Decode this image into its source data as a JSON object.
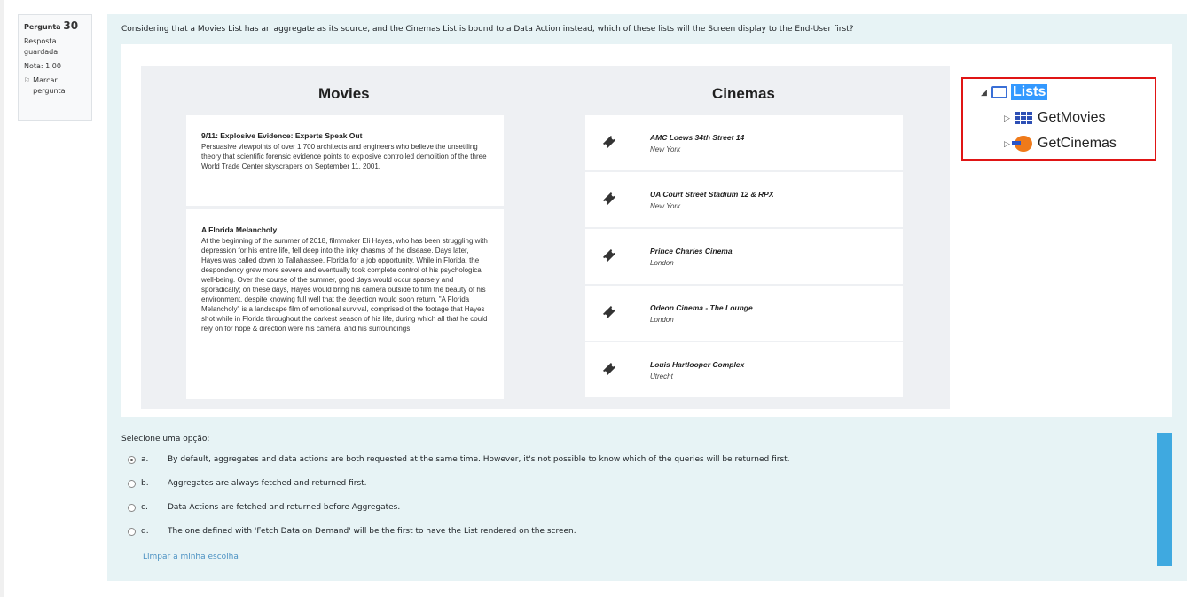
{
  "question_info": {
    "label": "Pergunta",
    "number": "30",
    "status": "Resposta guardada",
    "grade": "Nota: 1,00",
    "flag_label": "Marcar pergunta"
  },
  "question": {
    "text": "Considering that a Movies List has an aggregate as its source, and the Cinemas List is bound to a Data Action instead, which of these lists will the Screen display to the End-User first?"
  },
  "screen_preview": {
    "movies_title": "Movies",
    "cinemas_title": "Cinemas",
    "movies": [
      {
        "title": "9/11: Explosive Evidence: Experts Speak Out",
        "description": "Persuasive viewpoints of over 1,700 architects and engineers who believe the unsettling theory that scientific forensic evidence points to explosive controlled demolition of the three World Trade Center skyscrapers on September 11, 2001."
      },
      {
        "title": "A Florida Melancholy",
        "description": "At the beginning of the summer of 2018, filmmaker Eli Hayes, who has been struggling with depression for his entire life, fell deep into the inky chasms of the disease. Days later, Hayes was called down to Tallahassee, Florida for a job opportunity. While in Florida, the despondency grew more severe and eventually took complete control of his psychological well-being. Over the course of the summer, good days would occur sparsely and sporadically; on these days, Hayes would bring his camera outside to film the beauty of his environment, despite knowing full well that the dejection would soon return. \"A Florida Melancholy\" is a landscape film of emotional survival, comprised of the footage that Hayes shot while in Florida throughout the darkest season of his life, during which all that he could rely on for hope & direction were his camera, and his surroundings."
      }
    ],
    "cinemas": [
      {
        "name": "AMC Loews 34th Street 14",
        "city": "New York"
      },
      {
        "name": "UA Court Street Stadium 12 & RPX",
        "city": "New York"
      },
      {
        "name": "Prince Charles Cinema",
        "city": "London"
      },
      {
        "name": "Odeon Cinema - The Lounge",
        "city": "London"
      },
      {
        "name": "Louis Hartlooper Complex",
        "city": "Utrecht"
      }
    ]
  },
  "tree": {
    "root_label": "Lists",
    "items": [
      {
        "label": "GetMovies",
        "icon": "aggregate-grid-icon"
      },
      {
        "label": "GetCinemas",
        "icon": "data-action-icon"
      }
    ]
  },
  "answer": {
    "prompt": "Selecione uma opção:",
    "options": [
      {
        "letter": "a.",
        "text": "By default, aggregates and data actions are both requested at the same time. However, it's not possible to know which of the queries will be returned first.",
        "selected": true
      },
      {
        "letter": "b.",
        "text": "Aggregates are always fetched and returned first.",
        "selected": false
      },
      {
        "letter": "c.",
        "text": "Data Actions are fetched and returned before Aggregates.",
        "selected": false
      },
      {
        "letter": "d.",
        "text": "The one defined with 'Fetch Data on Demand' will be the first to have the List rendered on the screen.",
        "selected": false
      }
    ],
    "clear_label": "Limpar a minha escolha"
  },
  "colors": {
    "panel_bg": "#e7f3f5",
    "highlight_border": "#e01515",
    "selection_blue": "#3399ff",
    "link": "#4a90c2",
    "scroll_accent": "#3fa9e0"
  }
}
